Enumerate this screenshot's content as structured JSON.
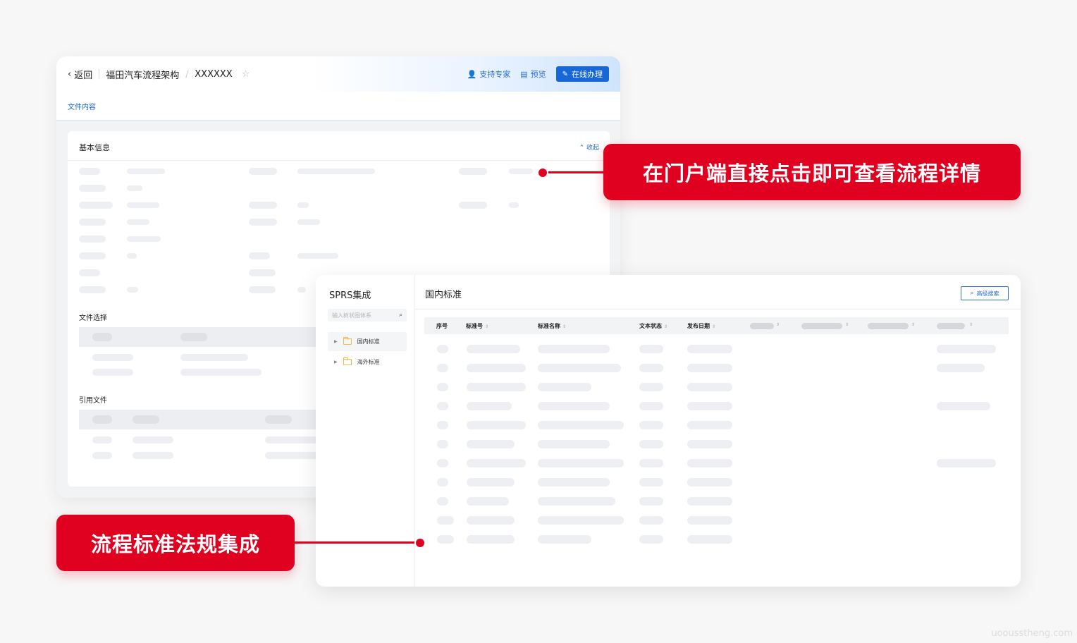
{
  "back_panel": {
    "back_label": "返回",
    "breadcrumb": [
      "福田汽车流程架构",
      "XXXXXX"
    ],
    "support_label": "支持专家",
    "preview_label": "预览",
    "online_label": "在线办理",
    "tab_label": "文件内容",
    "basic_info_title": "基本信息",
    "collapse_label": "收起",
    "file_select_title": "文件选择",
    "ref_files_title": "引用文件"
  },
  "front_panel": {
    "side_title": "SPRS集成",
    "search_placeholder": "输入树状图体系",
    "tree": [
      {
        "label": "国内标准",
        "selected": true
      },
      {
        "label": "海外标准",
        "selected": false
      }
    ],
    "main_title": "国内标准",
    "advanced_search_label": "高级搜索",
    "columns": [
      "序号",
      "标准号",
      "标准名称",
      "文本状态",
      "发布日期"
    ],
    "row_count": 11
  },
  "callouts": {
    "portal_text": "在门户端直接点击即可查看流程详情",
    "integration_text": "流程标准法规集成"
  },
  "watermark": "uoousstheng.com",
  "colors": {
    "accent_red": "#e00020",
    "primary_blue": "#1867d6",
    "folder_yellow": "#f3b64a"
  }
}
